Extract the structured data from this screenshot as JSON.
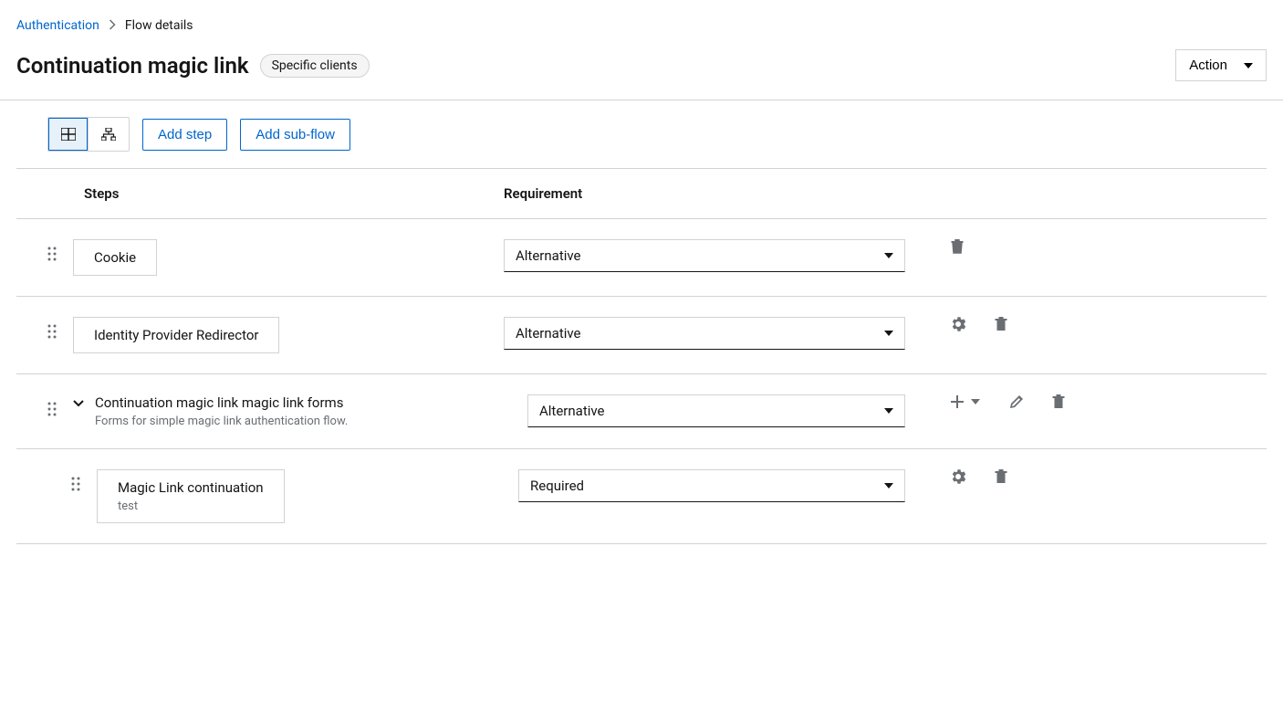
{
  "breadcrumb": {
    "parent": "Authentication",
    "current": "Flow details"
  },
  "header": {
    "title": "Continuation magic link",
    "badge": "Specific clients",
    "action_label": "Action"
  },
  "toolbar": {
    "add_step": "Add step",
    "add_subflow": "Add sub-flow"
  },
  "columns": {
    "steps": "Steps",
    "requirement": "Requirement"
  },
  "steps": [
    {
      "name": "Cookie",
      "requirement": "Alternative",
      "type": "leaf",
      "indent": 0,
      "actions": [
        "delete"
      ]
    },
    {
      "name": "Identity Provider Redirector",
      "requirement": "Alternative",
      "type": "leaf",
      "indent": 0,
      "actions": [
        "settings",
        "delete"
      ]
    },
    {
      "name": "Continuation magic link magic link forms",
      "description": "Forms for simple magic link authentication flow.",
      "requirement": "Alternative",
      "type": "subflow",
      "indent": 0,
      "actions": [
        "add",
        "edit",
        "delete"
      ]
    },
    {
      "name": "Magic Link continuation",
      "description": "test",
      "requirement": "Required",
      "type": "leaf",
      "indent": 1,
      "actions": [
        "settings",
        "delete"
      ]
    }
  ]
}
